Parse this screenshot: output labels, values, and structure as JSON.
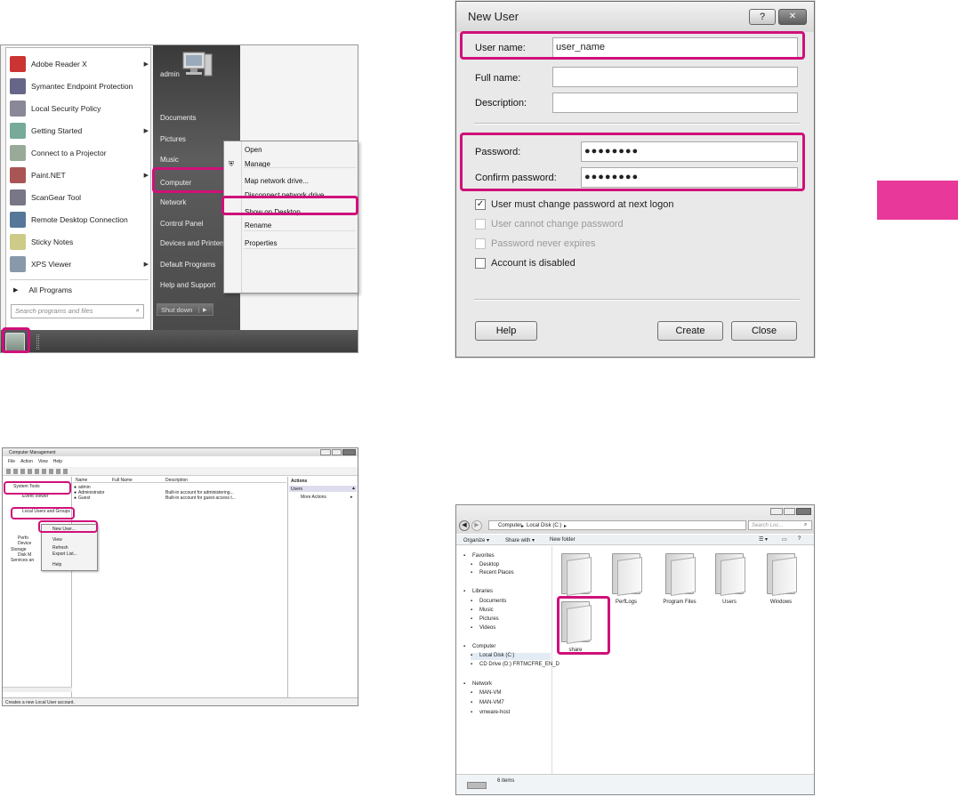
{
  "accent_color": "#d0107a",
  "start_menu": {
    "programs": [
      {
        "label": "Adobe Reader X",
        "icon": "adobe-reader-icon",
        "submenu": true
      },
      {
        "label": "Symantec Endpoint Protection",
        "icon": "symantec-icon",
        "submenu": false
      },
      {
        "label": "Local Security Policy",
        "icon": "security-policy-icon",
        "submenu": false
      },
      {
        "label": "Getting Started",
        "icon": "getting-started-icon",
        "submenu": true
      },
      {
        "label": "Connect to a Projector",
        "icon": "projector-icon",
        "submenu": false
      },
      {
        "label": "Paint.NET",
        "icon": "paint-icon",
        "submenu": true
      },
      {
        "label": "ScanGear Tool",
        "icon": "scangear-icon",
        "submenu": false
      },
      {
        "label": "Remote Desktop Connection",
        "icon": "remote-desktop-icon",
        "submenu": false
      },
      {
        "label": "Sticky Notes",
        "icon": "sticky-notes-icon",
        "submenu": false
      },
      {
        "label": "XPS Viewer",
        "icon": "xps-viewer-icon",
        "submenu": true
      }
    ],
    "all_programs": "All Programs",
    "search_placeholder": "Search programs and files",
    "right_items": [
      "admin",
      "Documents",
      "Pictures",
      "Music",
      "Computer",
      "Network",
      "Control Panel",
      "Devices and Printers",
      "Default Programs",
      "Help and Support"
    ],
    "shutdown": "Shut down"
  },
  "context_menu": {
    "items": [
      "Open",
      "Manage",
      "Map network drive...",
      "Disconnect network drive...",
      "Show on Desktop",
      "Rename",
      "Properties"
    ]
  },
  "new_user": {
    "title": "New User",
    "help_glyph": "?",
    "close_glyph": "✕",
    "user_name_label": "User name:",
    "user_name_value": "user_name",
    "full_name_label": "Full name:",
    "description_label": "Description:",
    "password_label": "Password:",
    "password_value": "●●●●●●●●",
    "confirm_label": "Confirm password:",
    "confirm_value": "●●●●●●●●",
    "options": [
      {
        "label": "User must change password at next logon",
        "checked": true,
        "disabled": false
      },
      {
        "label": "User cannot change password",
        "checked": false,
        "disabled": true
      },
      {
        "label": "Password never expires",
        "checked": false,
        "disabled": true
      },
      {
        "label": "Account is disabled",
        "checked": false,
        "disabled": false
      }
    ],
    "help_button": "Help",
    "create_button": "Create",
    "close_button": "Close"
  },
  "computer_management": {
    "title": "Computer Management",
    "menu": [
      "File",
      "Action",
      "View",
      "Help"
    ],
    "tree": [
      "System Tools",
      "Event Viewer",
      "Local Users and Groups",
      "Perfo",
      "Device",
      "Storage",
      "Disk M",
      "Services an"
    ],
    "columns": [
      "Name",
      "Full Name",
      "Description"
    ],
    "rows": [
      {
        "name": "admin",
        "full_name": "",
        "description": ""
      },
      {
        "name": "Administrator",
        "full_name": "",
        "description": "Built-in account for administering..."
      },
      {
        "name": "Guest",
        "full_name": "",
        "description": "Built-in account for guest access t..."
      }
    ],
    "actions_header": "Actions",
    "actions_sub": "Users",
    "more_actions": "More Actions",
    "context_items": [
      "New User...",
      "View",
      "Refresh",
      "Export List...",
      "Help"
    ],
    "status": "Creates a new Local User account."
  },
  "explorer": {
    "breadcrumb": [
      "Computer",
      "Local Disk (C:)"
    ],
    "search_placeholder": "Search Loc...",
    "toolbar": [
      "Organize ▾",
      "Share with ▾",
      "New folder"
    ],
    "nav": {
      "favorites": "Favorites",
      "fav_items": [
        "Desktop",
        "Recent Places"
      ],
      "libraries": "Libraries",
      "lib_items": [
        "Documents",
        "Music",
        "Pictures",
        "Videos"
      ],
      "computer": "Computer",
      "comp_items": [
        "Local Disk (C:)",
        "CD Drive (D:) FRTMCFRE_EN_D"
      ],
      "network": "Network",
      "net_items": [
        "MAN-VM",
        "MAN-VM7",
        "vmware-host"
      ]
    },
    "folders": [
      "",
      "PerfLogs",
      "Program Files",
      "Users",
      "Windows",
      "share"
    ],
    "status": "6 items"
  }
}
